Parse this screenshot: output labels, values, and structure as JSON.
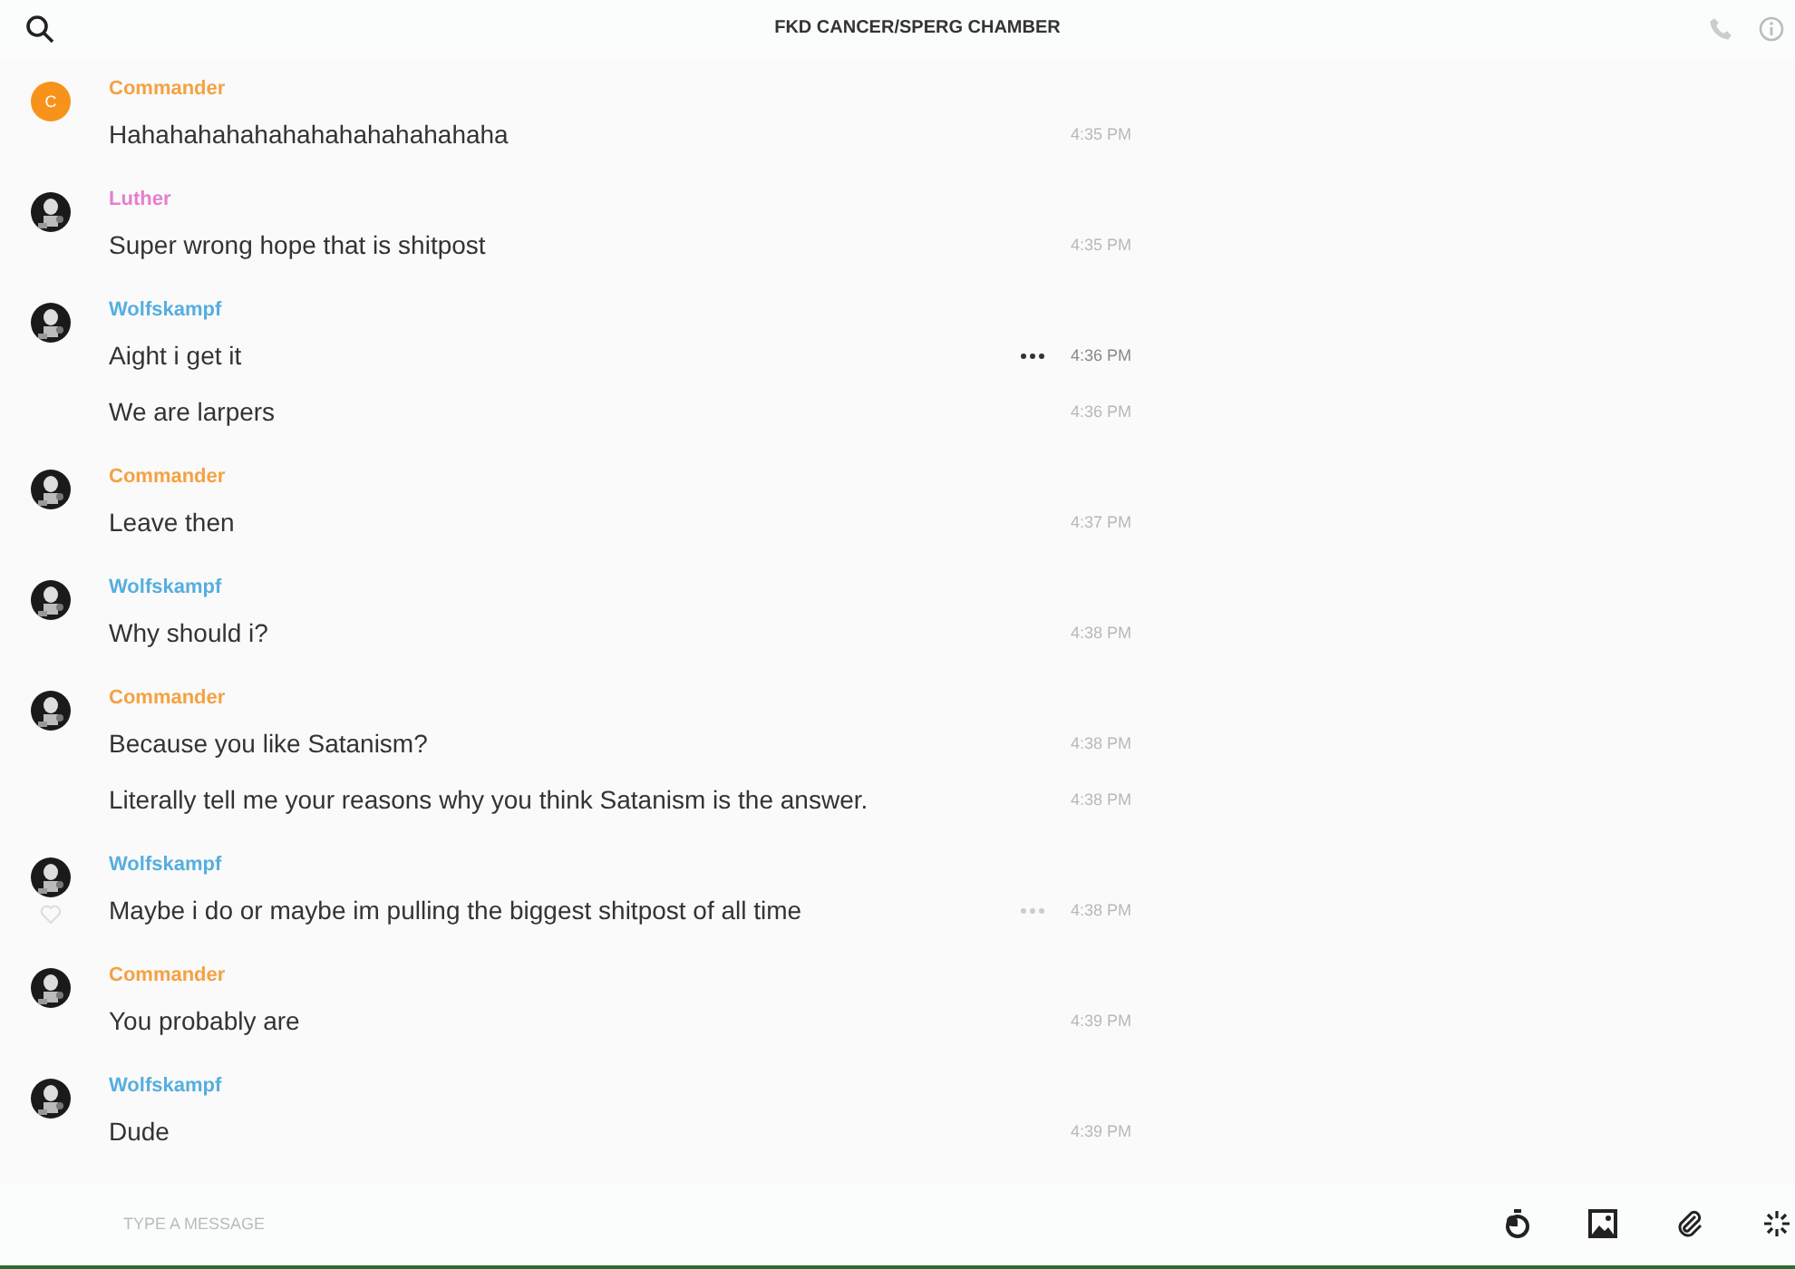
{
  "header": {
    "title": "FKD CANCER/SPERG CHAMBER"
  },
  "groups": [
    {
      "author": "Commander",
      "color": "#f5a142",
      "avatar": {
        "kind": "letter",
        "initial": "C"
      },
      "liked": false,
      "messages": [
        {
          "text": "Hahahahahahahahahahahahahaha",
          "time": "4:35 PM",
          "hovered": false,
          "menu": false
        }
      ]
    },
    {
      "author": "Luther",
      "color": "#e57ed0",
      "avatar": {
        "kind": "picture"
      },
      "liked": false,
      "messages": [
        {
          "text": "Super wrong hope that is shitpost",
          "time": "4:35 PM",
          "hovered": false,
          "menu": false
        }
      ]
    },
    {
      "author": "Wolfskampf",
      "color": "#55aee0",
      "avatar": {
        "kind": "picture"
      },
      "liked": false,
      "messages": [
        {
          "text": "Aight i get it",
          "time": "4:36 PM",
          "hovered": true,
          "menu": true
        },
        {
          "text": "We are larpers",
          "time": "4:36 PM",
          "hovered": false,
          "menu": false
        }
      ]
    },
    {
      "author": "Commander",
      "color": "#f5a142",
      "avatar": {
        "kind": "picture"
      },
      "liked": false,
      "messages": [
        {
          "text": "Leave then",
          "time": "4:37 PM",
          "hovered": false,
          "menu": false
        }
      ]
    },
    {
      "author": "Wolfskampf",
      "color": "#55aee0",
      "avatar": {
        "kind": "picture"
      },
      "liked": false,
      "messages": [
        {
          "text": "Why should i?",
          "time": "4:38 PM",
          "hovered": false,
          "menu": false
        }
      ]
    },
    {
      "author": "Commander",
      "color": "#f5a142",
      "avatar": {
        "kind": "picture"
      },
      "liked": false,
      "messages": [
        {
          "text": "Because you like Satanism?",
          "time": "4:38 PM",
          "hovered": false,
          "menu": false
        },
        {
          "text": "Literally tell me your reasons why you think Satanism is the answer.",
          "time": "4:38 PM",
          "hovered": false,
          "menu": false
        }
      ]
    },
    {
      "author": "Wolfskampf",
      "color": "#55aee0",
      "avatar": {
        "kind": "picture"
      },
      "liked": true,
      "messages": [
        {
          "text": "Maybe i do or maybe im pulling the biggest shitpost of all time",
          "time": "4:38 PM",
          "hovered": false,
          "menu": true
        }
      ]
    },
    {
      "author": "Commander",
      "color": "#f5a142",
      "avatar": {
        "kind": "picture"
      },
      "liked": false,
      "messages": [
        {
          "text": "You probably are",
          "time": "4:39 PM",
          "hovered": false,
          "menu": false
        }
      ]
    },
    {
      "author": "Wolfskampf",
      "color": "#55aee0",
      "avatar": {
        "kind": "picture"
      },
      "liked": false,
      "messages": [
        {
          "text": "Dude",
          "time": "4:39 PM",
          "hovered": false,
          "menu": false
        }
      ]
    }
  ],
  "composer": {
    "placeholder": "TYPE A MESSAGE"
  }
}
